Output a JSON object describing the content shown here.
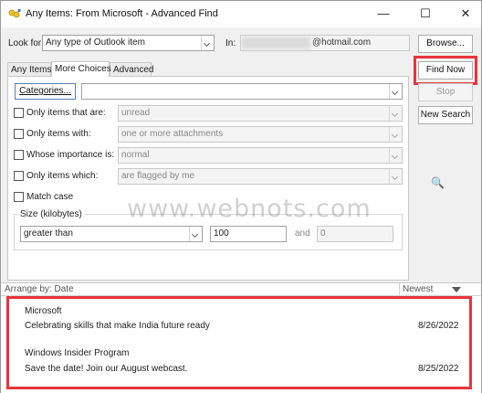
{
  "window": {
    "title": "Any Items: From Microsoft - Advanced Find",
    "minimize": "—",
    "maximize": "☐",
    "close": "✕"
  },
  "search": {
    "look_for_label": "Look for:",
    "look_for_value": "Any type of Outlook item",
    "in_label": "In:",
    "in_value": "@hotmail.com",
    "browse_label": "Browse..."
  },
  "tabs": [
    "Any Items",
    "More Choices",
    "Advanced"
  ],
  "actions": {
    "find_now": "Find Now",
    "stop": "Stop",
    "new_search": "New Search"
  },
  "more_choices": {
    "categories_button": "Categories...",
    "categories_value": "",
    "rows": [
      {
        "label": "Only items that are:",
        "value": "unread"
      },
      {
        "label": "Only items with:",
        "value": "one or more attachments"
      },
      {
        "label": "Whose importance is:",
        "value": "normal"
      },
      {
        "label": "Only items which:",
        "value": "are flagged by me"
      }
    ],
    "match_case": "Match case",
    "size_label": "Size (kilobytes)",
    "size_condition": "greater than",
    "size_value1": "100",
    "size_and": "and",
    "size_value2": "0"
  },
  "icons": {
    "search_icon": "🔍"
  },
  "results_header": {
    "arrange_by": "Arrange by: Date",
    "sort": "Newest"
  },
  "results": [
    {
      "sender": "Microsoft",
      "subject": "Celebrating skills that make India future ready",
      "date": "8/26/2022"
    },
    {
      "sender": "Windows Insider Program",
      "subject": "Save the date! Join our August webcast.",
      "date": "8/25/2022"
    }
  ],
  "watermark": "www.webnots.com",
  "colors": {
    "highlight": "#e8343c",
    "window_bg": "#f0f0f0"
  }
}
